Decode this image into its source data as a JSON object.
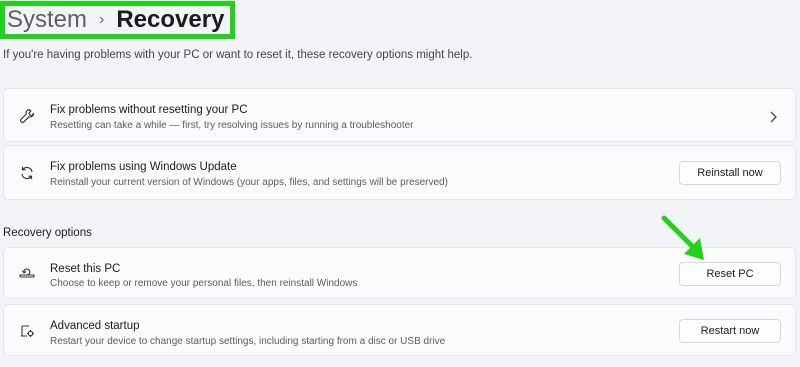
{
  "breadcrumb": {
    "parent": "System",
    "separator": "›",
    "current": "Recovery"
  },
  "subtitle": "If you're having problems with your PC or want to reset it, these recovery options might help.",
  "cards": [
    {
      "icon": "wrench-icon",
      "title": "Fix problems without resetting your PC",
      "description": "Resetting can take a while — first, try resolving issues by running a troubleshooter",
      "action": "chevron-right-icon"
    },
    {
      "icon": "refresh-icon",
      "title": "Fix problems using Windows Update",
      "description": "Reinstall your current version of Windows (your apps, files, and settings will be preserved)",
      "button": "Reinstall now"
    }
  ],
  "recovery_options": {
    "label": "Recovery options",
    "items": [
      {
        "icon": "reset-pc-icon",
        "title": "Reset this PC",
        "description": "Choose to keep or remove your personal files, then reinstall Windows",
        "button": "Reset PC"
      },
      {
        "icon": "advanced-startup-icon",
        "title": "Advanced startup",
        "description": "Restart your device to change startup settings, including starting from a disc or USB drive",
        "button": "Restart now"
      }
    ]
  },
  "annotation_colors": {
    "highlight": "#22d11a",
    "arrow": "#22d11a"
  }
}
